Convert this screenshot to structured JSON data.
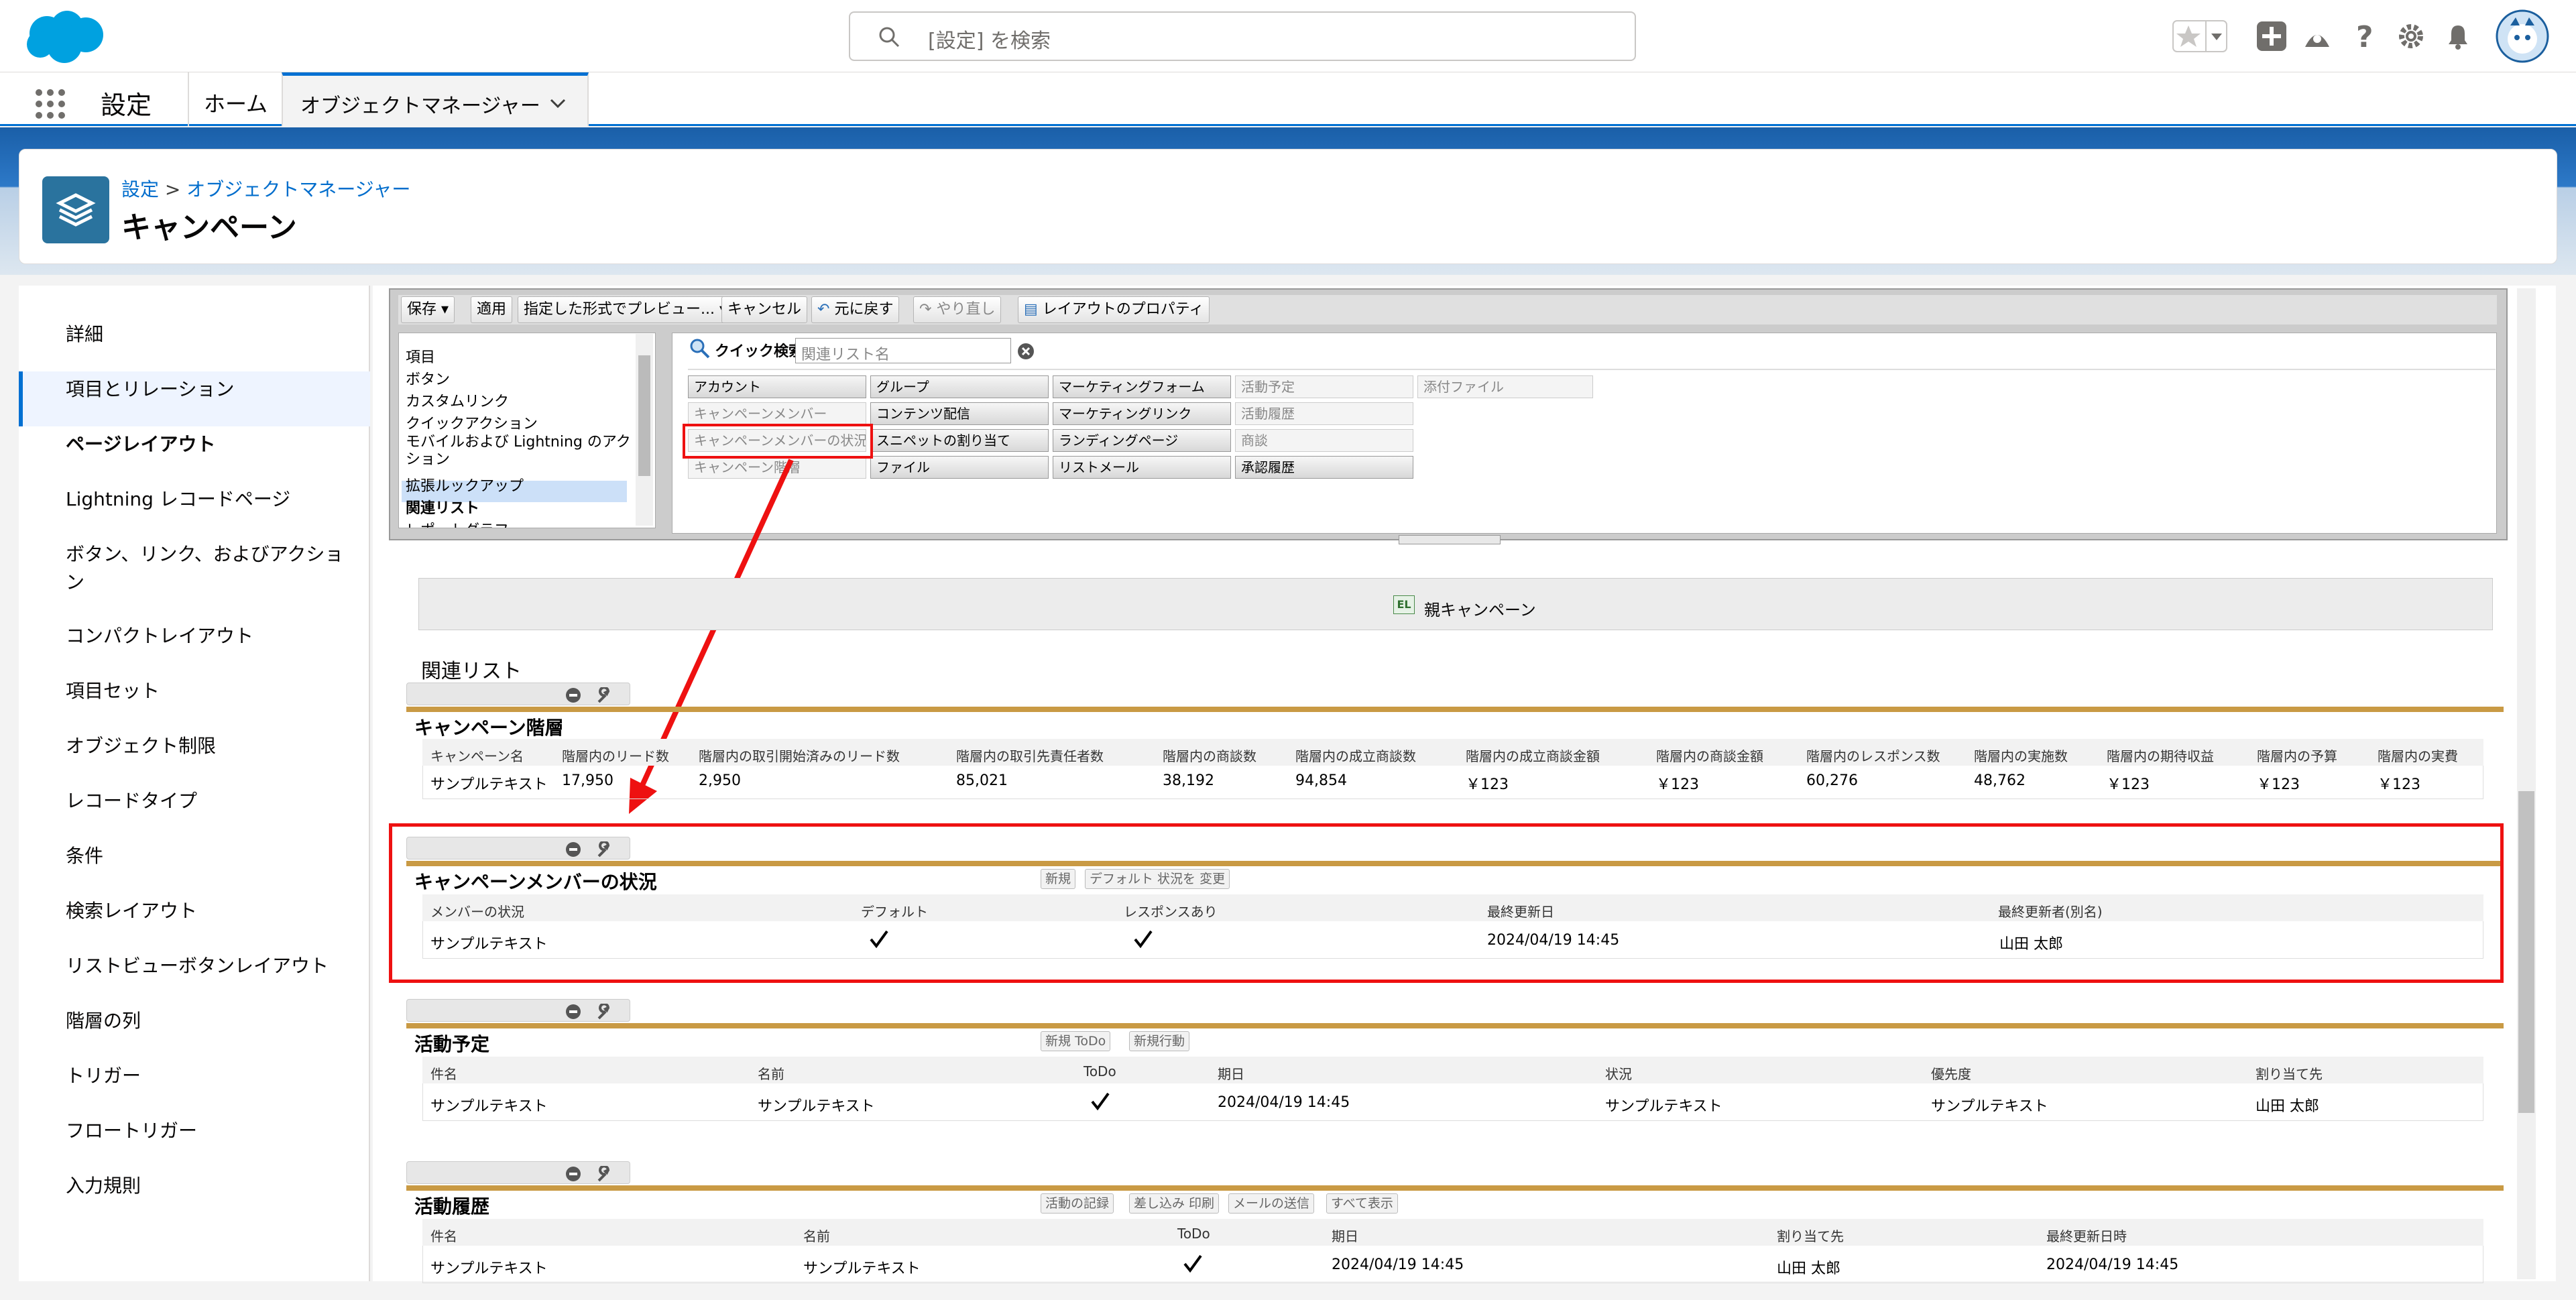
{
  "header": {
    "search_placeholder": "[設定] を検索"
  },
  "nav": {
    "app_name": "設定",
    "tabs": [
      "ホーム",
      "オブジェクトマネージャー"
    ]
  },
  "page": {
    "breadcrumb": [
      "設定",
      "オブジェクトマネージャー"
    ],
    "breadcrumb_sep": ">",
    "title": "キャンペーン"
  },
  "sidebar": {
    "items": [
      "詳細",
      "項目とリレーション",
      "ページレイアウト",
      "Lightning レコードページ",
      "ボタン、リンク、およびアクション",
      "コンパクトレイアウト",
      "項目セット",
      "オブジェクト制限",
      "レコードタイプ",
      "条件",
      "検索レイアウト",
      "リストビューボタンレイアウト",
      "階層の列",
      "トリガー",
      "フロートリガー",
      "入力規則"
    ],
    "active": "ページレイアウト"
  },
  "toolbar": {
    "save": "保存",
    "apply": "適用",
    "preview": "指定した形式でプレビュー...",
    "cancel": "キャンセル",
    "undo": "元に戻す",
    "redo": "やり直し",
    "layout_props": "レイアウトのプロパティ"
  },
  "palette": {
    "categories": [
      "項目",
      "ボタン",
      "カスタムリンク",
      "クイックアクション",
      "モバイルおよび Lightning のアクション",
      "拡張ルックアップ",
      "関連リスト",
      "レポートグラフ"
    ],
    "selected_category": "関連リスト",
    "quick_search_label": "クイック検索",
    "quick_search_placeholder": "関連リスト名",
    "col1": [
      "アカウント",
      "キャンペーンメンバー",
      "キャンペーンメンバーの状況",
      "キャンペーン階層"
    ],
    "col2": [
      "グループ",
      "コンテンツ配信",
      "スニペットの割り当て",
      "ファイル"
    ],
    "col3": [
      "マーケティングフォーム",
      "マーケティングリンク",
      "ランディングページ",
      "リストメール"
    ],
    "col4": [
      "活動予定",
      "活動履歴",
      "商談",
      "承認履歴"
    ],
    "col5": [
      "添付ファイル"
    ]
  },
  "layout": {
    "parent_campaign": "親キャンペーン",
    "related_lists_heading": "関連リスト",
    "hierarchy": {
      "title": "キャンペーン階層",
      "headers": [
        "キャンペーン名",
        "階層内のリード数",
        "階層内の取引開始済みのリード数",
        "階層内の取引先責任者数",
        "階層内の商談数",
        "階層内の成立商談数",
        "階層内の成立商談金額",
        "階層内の商談金額",
        "階層内のレスポンス数",
        "階層内の実施数",
        "階層内の期待収益",
        "階層内の予算",
        "階層内の実費"
      ],
      "row": [
        "サンプルテキスト",
        "17,950",
        "2,950",
        "85,021",
        "38,192",
        "94,854",
        "￥123",
        "￥123",
        "60,276",
        "48,762",
        "￥123",
        "￥123",
        "￥123"
      ]
    },
    "member_status": {
      "title": "キャンペーンメンバーの状況",
      "buttons": [
        "新規",
        "デフォルト 状況を 変更"
      ],
      "headers": [
        "メンバーの状況",
        "デフォルト",
        "レスポンスあり",
        "最終更新日",
        "最終更新者(別名)"
      ],
      "row": [
        "サンプルテキスト",
        "",
        "",
        "2024/04/19 14:45",
        "山田 太郎"
      ]
    },
    "open_activities": {
      "title": "活動予定",
      "buttons": [
        "新規 ToDo",
        "新規行動"
      ],
      "headers": [
        "件名",
        "名前",
        "ToDo",
        "期日",
        "状況",
        "優先度",
        "割り当て先"
      ],
      "row": [
        "サンプルテキスト",
        "サンプルテキスト",
        "",
        "2024/04/19 14:45",
        "サンプルテキスト",
        "サンプルテキスト",
        "山田 太郎"
      ]
    },
    "activity_history": {
      "title": "活動履歴",
      "buttons": [
        "活動の記録",
        "差し込み 印刷",
        "メールの送信",
        "すべて表示"
      ],
      "headers": [
        "件名",
        "名前",
        "ToDo",
        "期日",
        "割り当て先",
        "最終更新日時"
      ],
      "row": [
        "サンプルテキスト",
        "サンプルテキスト",
        "",
        "2024/04/19 14:45",
        "山田 太郎",
        "2024/04/19 14:45"
      ]
    }
  },
  "colors": {
    "brand_blue": "#0070d2",
    "section_gold": "#c99a44",
    "highlight_red": "#ee1111"
  }
}
